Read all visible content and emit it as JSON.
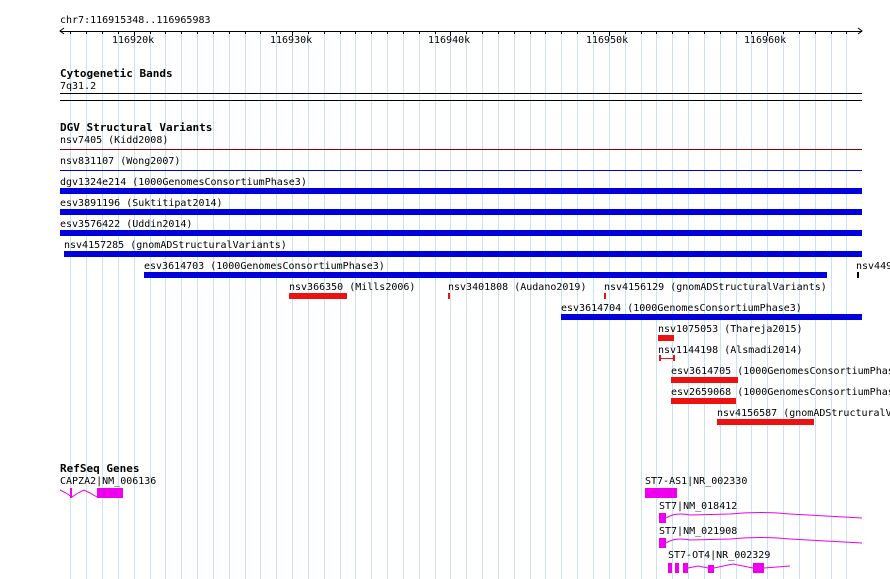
{
  "view": {
    "locus": "chr7:116915348..116965983",
    "start": 116915348,
    "end": 116965983,
    "ticks": [
      "116920k",
      "116930k",
      "116940k",
      "116950k",
      "116960k"
    ]
  },
  "cytoband": {
    "title": "Cytogenetic Bands",
    "band": "7q31.2"
  },
  "dgv": {
    "title": "DGV Structural Variants",
    "colors": {
      "blue": "#0000dd",
      "red": "#ee1111",
      "maroon": "#880000"
    },
    "features": [
      {
        "label": "nsv7405 (Kidd2008)",
        "color": "maroon",
        "thin": true
      },
      {
        "label": "nsv831107 (Wong2007)",
        "color": "blue",
        "thin": true
      },
      {
        "label": "dgv1324e214 (1000GenomesConsortiumPhase3)",
        "color": "blue"
      },
      {
        "label": "esv3891196 (Suktitipat2014)",
        "color": "blue"
      },
      {
        "label": "esv3576422 (Uddin2014)",
        "color": "blue"
      },
      {
        "label": "nsv4157285 (gnomADStructuralVariants)",
        "color": "blue"
      },
      {
        "label": "esv3614703 (1000GenomesConsortiumPhase3)",
        "color": "blue"
      },
      {
        "label": "nsv449",
        "color": "blue"
      },
      {
        "label": "nsv366350 (Mills2006)",
        "color": "red"
      },
      {
        "label": "nsv3401808 (Audano2019)",
        "color": "red"
      },
      {
        "label": "nsv4156129 (gnomADStructuralVariants)",
        "color": "red"
      },
      {
        "label": "esv3614704 (1000GenomesConsortiumPhase3)",
        "color": "blue"
      },
      {
        "label": "nsv1075053 (Thareja2015)",
        "color": "red"
      },
      {
        "label": "nsv1144198 (Alsmadi2014)",
        "color": "red"
      },
      {
        "label": "esv3614705 (1000GenomesConsortiumPhas",
        "color": "red"
      },
      {
        "label": "esv2659068 (1000GenomesConsortiumPhas",
        "color": "red"
      },
      {
        "label": "nsv4156587 (gnomADStructuralV",
        "color": "red"
      }
    ]
  },
  "refseq": {
    "title": "RefSeq Genes",
    "color": "#ee00ee",
    "genes": [
      {
        "label": "CAPZA2|NM_006136"
      },
      {
        "label": "ST7-AS1|NR_002330"
      },
      {
        "label": "ST7|NM_018412"
      },
      {
        "label": "ST7|NM_021908"
      },
      {
        "label": "ST7-OT4|NR_002329"
      }
    ]
  }
}
